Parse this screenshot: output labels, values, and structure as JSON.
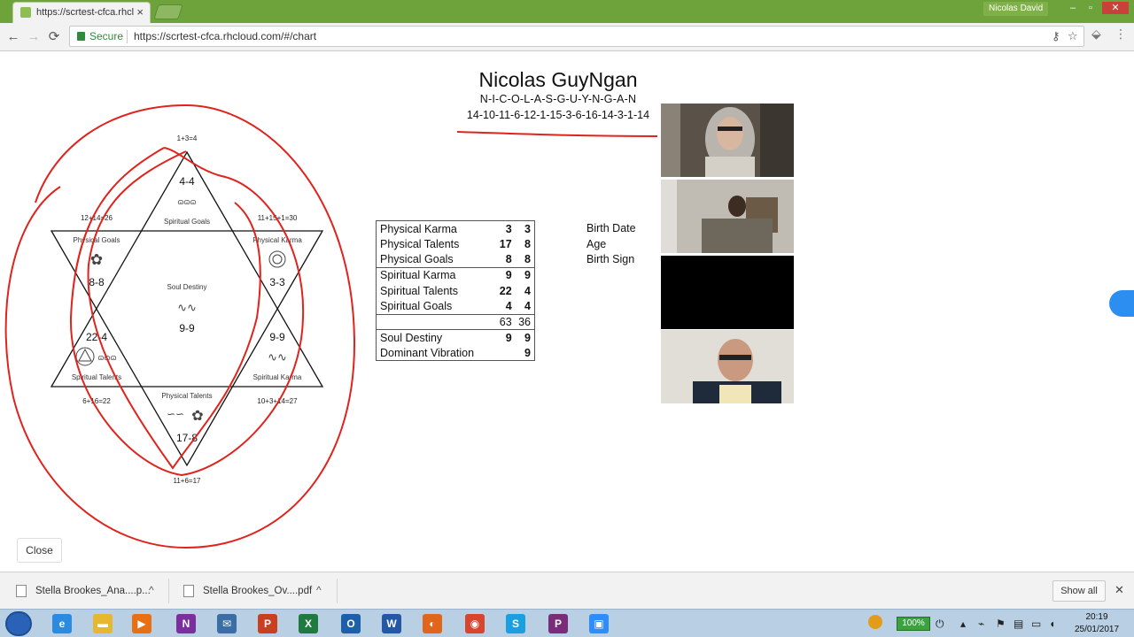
{
  "browser": {
    "tab_title": "https://scrtest-cfca.rhclou",
    "tab_close": "×",
    "profile_name": "Nicolas David",
    "secure_label": "Secure",
    "url": "https://scrtest-cfca.rhcloud.com/#/chart",
    "back_icon": "←",
    "forward_icon": "→",
    "reload_icon": "⟳",
    "star_icon": "☆",
    "key_icon": "⚷",
    "menu_icon": "⋮"
  },
  "chart": {
    "person_name": "Nicolas GuyNgan",
    "name_letters": "N-I-C-O-L-A-S-G-U-Y-N-G-A-N",
    "name_numbers": "14-10-11-6-12-1-15-3-6-16-14-3-1-14",
    "star": {
      "top_sum": "1+3=4",
      "top_value": "4-4",
      "top_label": "Spiritual Goals",
      "upper_left_sum": "12+14=26",
      "upper_left_label": "Physical Goals",
      "upper_left_value": "8-8",
      "upper_right_sum": "11+15+1=30",
      "upper_right_label": "Physical Karma",
      "upper_right_value": "3-3",
      "center_label": "Soul Destiny",
      "center_value": "9-9",
      "lower_left_value": "22-4",
      "lower_left_label": "Spiritual Talents",
      "lower_left_sum": "6+16=22",
      "lower_right_value": "9-9",
      "lower_right_label": "Spiritual Karma",
      "lower_right_sum": "10+3+14=27",
      "bottom_label": "Physical Talents",
      "bottom_value": "17-8",
      "bottom_sum": "11+6=17"
    },
    "results": {
      "physical": [
        {
          "label": "Physical Karma",
          "a": "3",
          "b": "3"
        },
        {
          "label": "Physical Talents",
          "a": "17",
          "b": "8"
        },
        {
          "label": "Physical Goals",
          "a": "8",
          "b": "8"
        }
      ],
      "spiritual": [
        {
          "label": "Spiritual Karma",
          "a": "9",
          "b": "9"
        },
        {
          "label": "Spiritual Talents",
          "a": "22",
          "b": "4"
        },
        {
          "label": "Spiritual Goals",
          "a": "4",
          "b": "4"
        }
      ],
      "total_a": "63",
      "total_b": "36",
      "soul_destiny_label": "Soul Destiny",
      "soul_destiny_a": "9",
      "soul_destiny_b": "9",
      "dominant_label": "Dominant Vibration",
      "dominant_b": "9"
    },
    "birth": {
      "date_label": "Birth Date",
      "age_label": "Age",
      "sign_label": "Birth Sign"
    },
    "close_label": "Close"
  },
  "downloads": {
    "items": [
      {
        "name": "Stella Brookes_Ana....p..."
      },
      {
        "name": "Stella Brookes_Ov....pdf"
      }
    ],
    "show_all": "Show all",
    "close_icon": "✕",
    "caret": "^"
  },
  "taskbar": {
    "battery": "100%",
    "time": "20:19",
    "date": "25/01/2017",
    "apps": [
      {
        "name": "internet-explorer",
        "glyph": "e",
        "color": "#2b8be0"
      },
      {
        "name": "file-explorer",
        "glyph": "▬",
        "color": "#e8b730"
      },
      {
        "name": "media-player",
        "glyph": "▶",
        "color": "#e86f12"
      },
      {
        "name": "onenote",
        "glyph": "N",
        "color": "#7b2f9e"
      },
      {
        "name": "thunderbird",
        "glyph": "✉",
        "color": "#3a6ea5"
      },
      {
        "name": "powerpoint",
        "glyph": "P",
        "color": "#c8401f"
      },
      {
        "name": "excel",
        "glyph": "X",
        "color": "#1f7a3f"
      },
      {
        "name": "outlook",
        "glyph": "O",
        "color": "#1d5fa8"
      },
      {
        "name": "word",
        "glyph": "W",
        "color": "#2457a6"
      },
      {
        "name": "firefox",
        "glyph": "◐",
        "color": "#e0661c"
      },
      {
        "name": "chrome",
        "glyph": "◉",
        "color": "#d9442f"
      },
      {
        "name": "skype",
        "glyph": "S",
        "color": "#1aa0e0"
      },
      {
        "name": "pdf-tool",
        "glyph": "P",
        "color": "#7a2c7a"
      },
      {
        "name": "zoom",
        "glyph": "▣",
        "color": "#2d8cff"
      }
    ]
  }
}
